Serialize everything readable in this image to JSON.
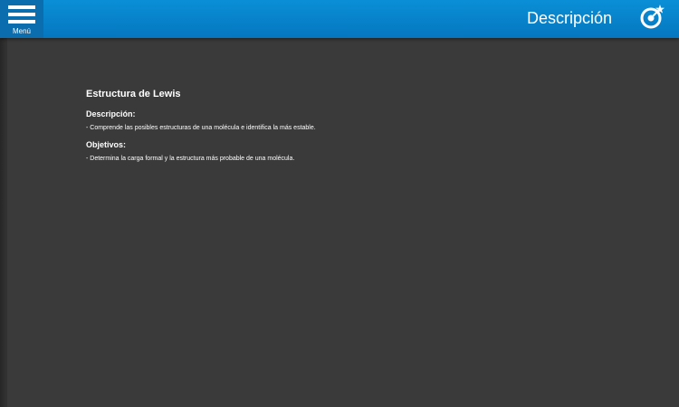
{
  "header": {
    "menu_label": "Menú",
    "title": "Descripción",
    "logo_icon": "target-star-icon",
    "menu_icon": "hamburger-icon",
    "accent_color": "#0a85cf"
  },
  "content": {
    "title": "Estructura de Lewis",
    "description_heading": "Descripción:",
    "description_text": "- Comprende las posibles estructuras de una molécula e identifica la más estable.",
    "objectives_heading": "Objetivos:",
    "objectives_text": "- Determina la carga formal y la estructura más probable de una molécula."
  }
}
